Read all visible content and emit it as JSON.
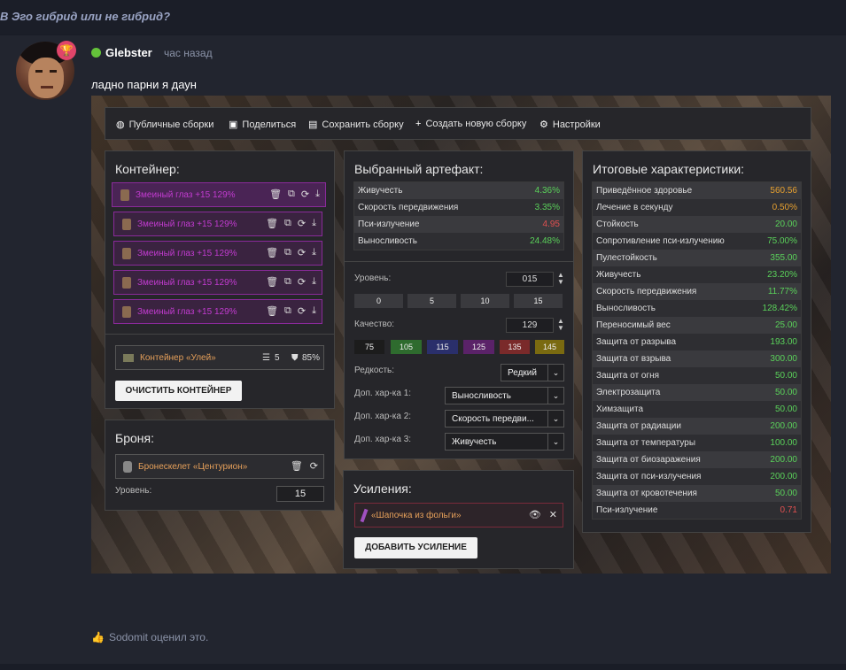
{
  "thread": {
    "title": "В Эго гибрид или не гибрид?"
  },
  "post": {
    "username": "Glebster",
    "time": "час назад",
    "message": "ладно парни я даун",
    "reaction_text": "Sodomit оценил это."
  },
  "toolbar": {
    "items": [
      {
        "label": "Публичные сборки"
      },
      {
        "label": "Поделиться"
      },
      {
        "label": "Сохранить сборку"
      },
      {
        "label": "Создать новую сборку"
      },
      {
        "label": "Настройки"
      }
    ]
  },
  "container": {
    "title": "Контейнер:",
    "slots": [
      {
        "label": "Змеиный глаз +15 129%"
      },
      {
        "label": "Змеиный глаз +15 129%"
      },
      {
        "label": "Змеиный глаз +15 129%"
      },
      {
        "label": "Змеиный глаз +15 129%"
      },
      {
        "label": "Змеиный глаз +15 129%"
      }
    ],
    "item": {
      "label": "Контейнер «Улей»",
      "slots": "5",
      "protection": "85%"
    },
    "clear_button": "ОЧИСТИТЬ КОНТЕЙНЕР"
  },
  "armor": {
    "title": "Броня:",
    "item": "Бронескелет «Центурион»",
    "level_label": "Уровень:",
    "level_value": "15"
  },
  "artifact": {
    "title": "Выбранный артефакт:",
    "stats": [
      {
        "name": "Живучесть",
        "value": "4.36%",
        "color": "#5ad15a"
      },
      {
        "name": "Скорость передвижения",
        "value": "3.35%",
        "color": "#5ad15a"
      },
      {
        "name": "Пси-излучение",
        "value": "4.95",
        "color": "#e05050"
      },
      {
        "name": "Выносливость",
        "value": "24.48%",
        "color": "#5ad15a"
      }
    ],
    "level_label": "Уровень:",
    "level_value": "015",
    "level_presets": [
      "0",
      "5",
      "10",
      "15"
    ],
    "quality_label": "Качество:",
    "quality_value": "129",
    "quality_presets": [
      {
        "label": "75",
        "color": "#1c1c1c"
      },
      {
        "label": "105",
        "color": "#2e6b2e"
      },
      {
        "label": "115",
        "color": "#2a2f6b"
      },
      {
        "label": "125",
        "color": "#5a2268"
      },
      {
        "label": "135",
        "color": "#7a2a2a"
      },
      {
        "label": "145",
        "color": "#7a6a10"
      }
    ],
    "rarity_label": "Редкость:",
    "rarity_value": "Редкий",
    "extra1_label": "Доп. хар-ка 1:",
    "extra1_value": "Выносливость",
    "extra2_label": "Доп. хар-ка 2:",
    "extra2_value": "Скорость передви...",
    "extra3_label": "Доп. хар-ка 3:",
    "extra3_value": "Живучесть"
  },
  "boosts": {
    "title": "Усиления:",
    "item": "«Шапочка из фольги»",
    "add_button": "ДОБАВИТЬ УСИЛЕНИЕ"
  },
  "totals": {
    "title": "Итоговые характеристики:",
    "stats": [
      {
        "name": "Приведённое здоровье",
        "value": "560.56",
        "color": "#e6a030"
      },
      {
        "name": "Лечение в секунду",
        "value": "0.50%",
        "color": "#e6a030"
      },
      {
        "name": "Стойкость",
        "value": "20.00",
        "color": "#5ad15a"
      },
      {
        "name": "Сопротивление пси-излучению",
        "value": "75.00%",
        "color": "#5ad15a"
      },
      {
        "name": "Пулестойкость",
        "value": "355.00",
        "color": "#5ad15a"
      },
      {
        "name": "Живучесть",
        "value": "23.20%",
        "color": "#5ad15a"
      },
      {
        "name": "Скорость передвижения",
        "value": "11.77%",
        "color": "#5ad15a"
      },
      {
        "name": "Выносливость",
        "value": "128.42%",
        "color": "#5ad15a"
      },
      {
        "name": "Переносимый вес",
        "value": "25.00",
        "color": "#5ad15a"
      },
      {
        "name": "Защита от разрыва",
        "value": "193.00",
        "color": "#5ad15a"
      },
      {
        "name": "Защита от взрыва",
        "value": "300.00",
        "color": "#5ad15a"
      },
      {
        "name": "Защита от огня",
        "value": "50.00",
        "color": "#5ad15a"
      },
      {
        "name": "Электрозащита",
        "value": "50.00",
        "color": "#5ad15a"
      },
      {
        "name": "Химзащита",
        "value": "50.00",
        "color": "#5ad15a"
      },
      {
        "name": "Защита от радиации",
        "value": "200.00",
        "color": "#5ad15a"
      },
      {
        "name": "Защита от температуры",
        "value": "100.00",
        "color": "#5ad15a"
      },
      {
        "name": "Защита от биозаражения",
        "value": "200.00",
        "color": "#5ad15a"
      },
      {
        "name": "Защита от пси-излучения",
        "value": "200.00",
        "color": "#5ad15a"
      },
      {
        "name": "Защита от кровотечения",
        "value": "50.00",
        "color": "#5ad15a"
      },
      {
        "name": "Пси-излучение",
        "value": "0.71",
        "color": "#e05050"
      }
    ]
  }
}
